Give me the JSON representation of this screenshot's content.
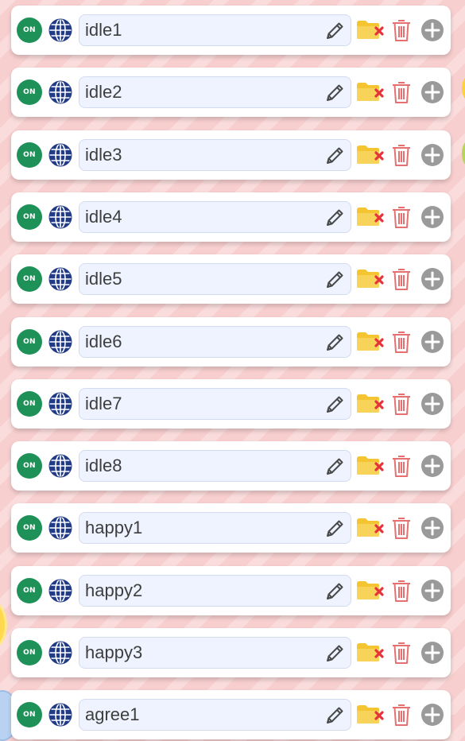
{
  "toggle_label": "ON",
  "colors": {
    "toggle_on": "#1e9158",
    "globe": "#213b87",
    "folder": "#f4c431",
    "folder_x": "#e5323b",
    "trash": "#e66f6f",
    "plus": "#9a9a9a",
    "name_box_bg": "#eef3ff",
    "page_bg": "#f8cfcf"
  },
  "icons": {
    "toggle": "on-toggle-icon",
    "web": "globe-icon",
    "edit": "pencil-icon",
    "remove_folder": "folder-x-icon",
    "delete": "trash-icon",
    "add": "plus-circle-icon"
  },
  "rows": [
    {
      "name": "idle1"
    },
    {
      "name": "idle2"
    },
    {
      "name": "idle3"
    },
    {
      "name": "idle4"
    },
    {
      "name": "idle5"
    },
    {
      "name": "idle6"
    },
    {
      "name": "idle7"
    },
    {
      "name": "idle8"
    },
    {
      "name": "happy1"
    },
    {
      "name": "happy2"
    },
    {
      "name": "happy3"
    },
    {
      "name": "agree1"
    }
  ]
}
